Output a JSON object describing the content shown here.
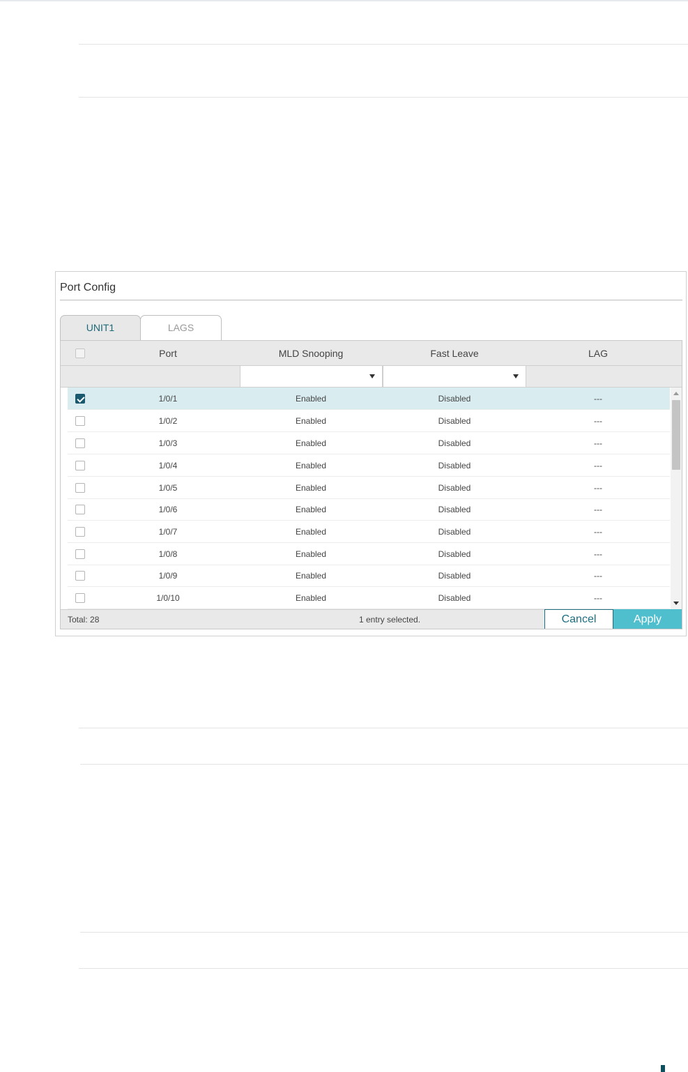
{
  "panel": {
    "title": "Port Config",
    "tabs": [
      {
        "label": "UNIT1",
        "active": true
      },
      {
        "label": "LAGS",
        "active": false
      }
    ],
    "columns": {
      "port": "Port",
      "mld_snooping": "MLD Snooping",
      "fast_leave": "Fast Leave",
      "lag": "LAG"
    },
    "filters": {
      "mld_snooping": "",
      "fast_leave": ""
    },
    "rows": [
      {
        "port": "1/0/1",
        "mld": "Enabled",
        "fast": "Disabled",
        "lag": "---",
        "checked": true
      },
      {
        "port": "1/0/2",
        "mld": "Enabled",
        "fast": "Disabled",
        "lag": "---",
        "checked": false
      },
      {
        "port": "1/0/3",
        "mld": "Enabled",
        "fast": "Disabled",
        "lag": "---",
        "checked": false
      },
      {
        "port": "1/0/4",
        "mld": "Enabled",
        "fast": "Disabled",
        "lag": "---",
        "checked": false
      },
      {
        "port": "1/0/5",
        "mld": "Enabled",
        "fast": "Disabled",
        "lag": "---",
        "checked": false
      },
      {
        "port": "1/0/6",
        "mld": "Enabled",
        "fast": "Disabled",
        "lag": "---",
        "checked": false
      },
      {
        "port": "1/0/7",
        "mld": "Enabled",
        "fast": "Disabled",
        "lag": "---",
        "checked": false
      },
      {
        "port": "1/0/8",
        "mld": "Enabled",
        "fast": "Disabled",
        "lag": "---",
        "checked": false
      },
      {
        "port": "1/0/9",
        "mld": "Enabled",
        "fast": "Disabled",
        "lag": "---",
        "checked": false
      },
      {
        "port": "1/0/10",
        "mld": "Enabled",
        "fast": "Disabled",
        "lag": "---",
        "checked": false
      }
    ],
    "footer": {
      "total": "Total: 28",
      "selected_info": "1 entry selected.",
      "cancel_label": "Cancel",
      "apply_label": "Apply"
    }
  },
  "icons": {
    "checkbox": "checkbox-icon",
    "dropdown": "chevron-down-icon",
    "scroll_up": "arrow-up-icon",
    "scroll_down": "arrow-down-icon"
  },
  "colors": {
    "accent": "#1b5a6e",
    "apply_button": "#4fbfcd",
    "selected_row": "#d9edf1",
    "active_tab_text": "#1d6877"
  }
}
